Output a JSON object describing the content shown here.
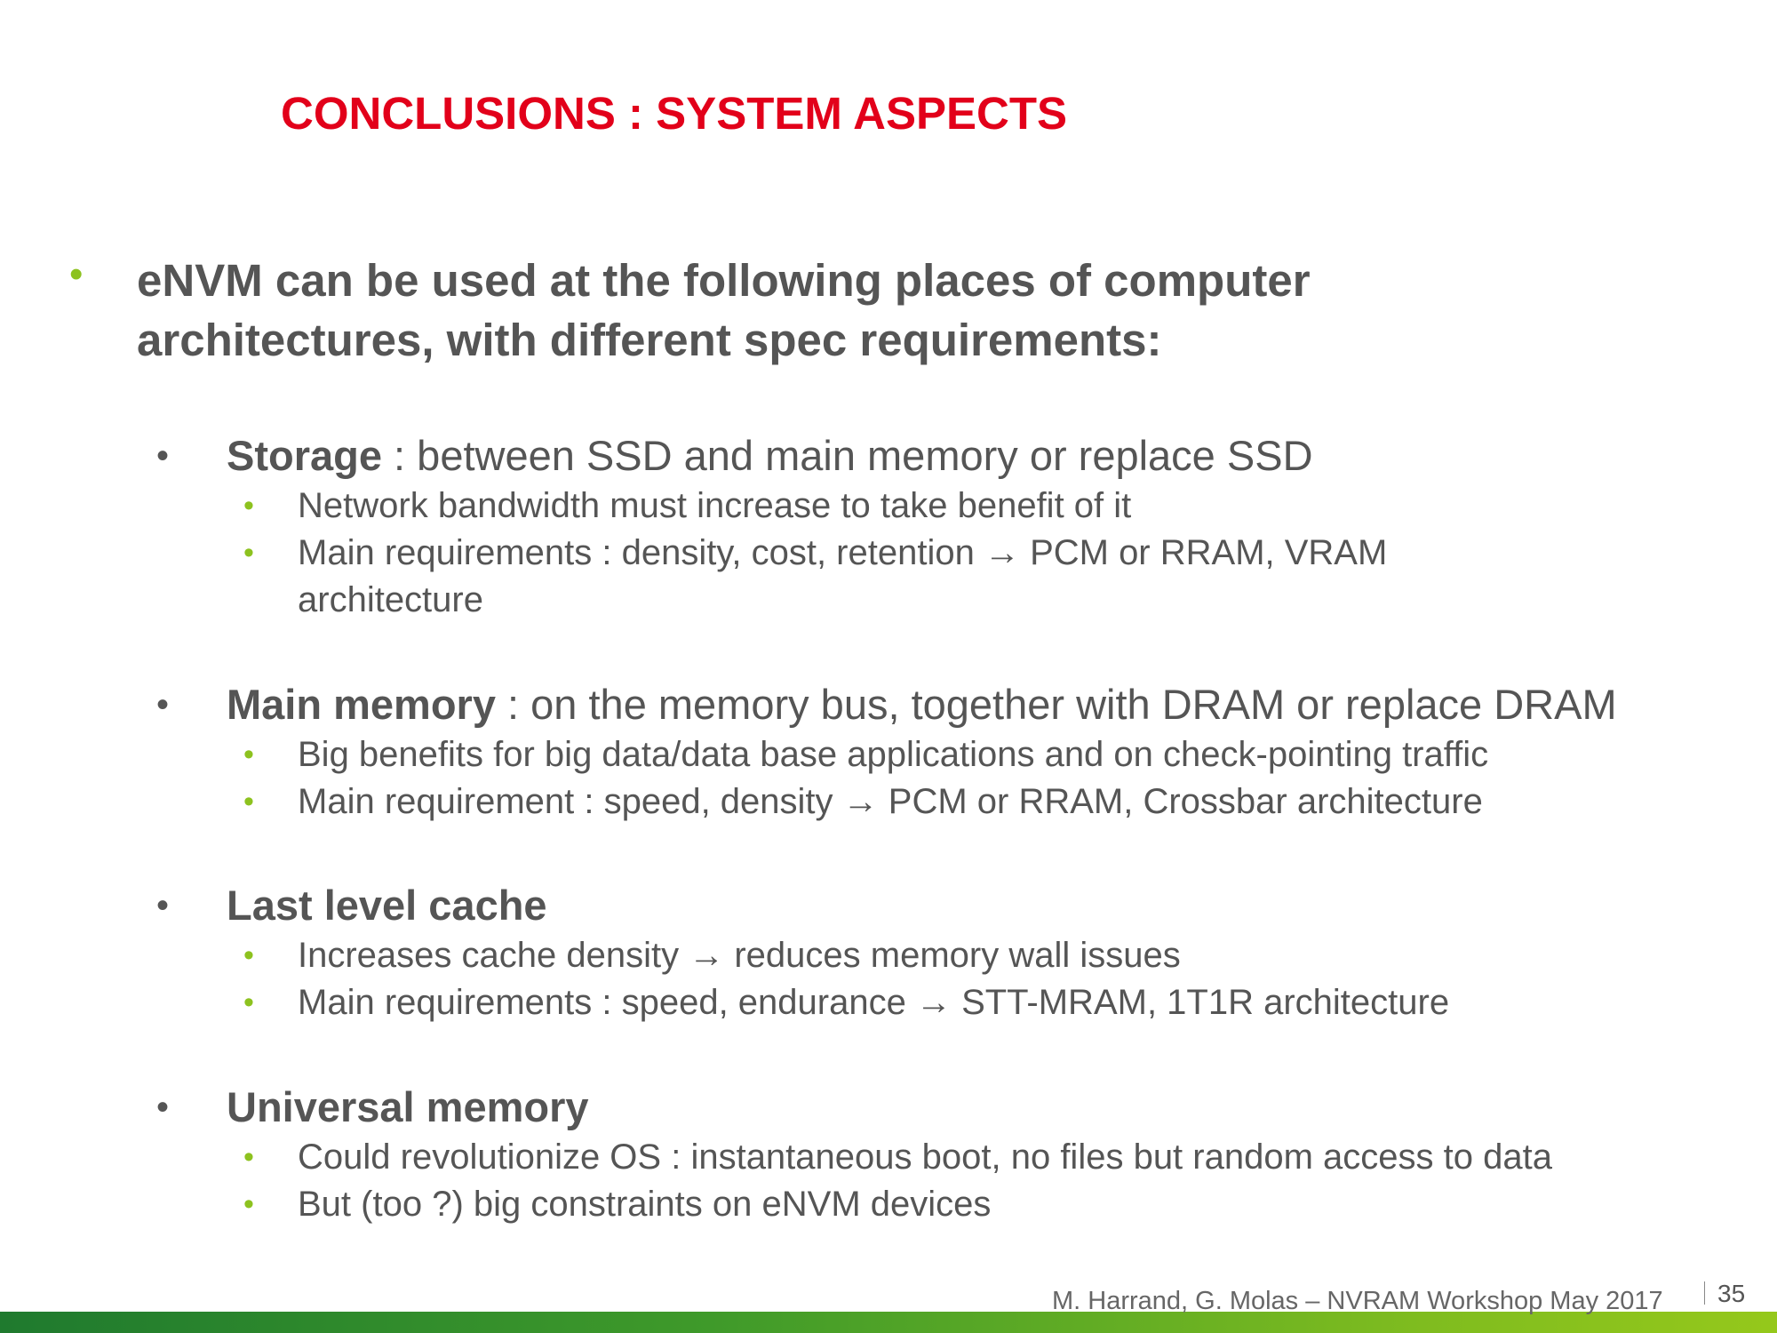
{
  "slide": {
    "title": "CONCLUSIONS : SYSTEM ASPECTS",
    "intro": {
      "bullet": "•",
      "text": "eNVM can be used at the following places of computer architectures, with different spec requirements:"
    },
    "sections": [
      {
        "bullet": "•",
        "heading": "Storage",
        "rest": " : between SSD and main memory or replace SSD",
        "subs": [
          "Network bandwidth must increase to take benefit of it",
          "Main requirements : density, cost, retention → PCM or RRAM, VRAM architecture"
        ]
      },
      {
        "bullet": "•",
        "heading": "Main memory",
        "rest": " : on the memory bus, together with DRAM or replace DRAM",
        "subs": [
          "Big benefits for big data/data base applications and on check-pointing traffic",
          "Main requirement : speed, density → PCM or RRAM, Crossbar architecture"
        ]
      },
      {
        "bullet": "•",
        "heading": "Last level cache",
        "rest": "",
        "subs": [
          "Increases cache density → reduces memory wall issues",
          "Main requirements : speed, endurance → STT-MRAM, 1T1R architecture"
        ]
      },
      {
        "bullet": "•",
        "heading": "Universal memory",
        "rest": "",
        "subs": [
          "Could revolutionize OS : instantaneous boot, no files but random access to data",
          "But (too ?) big constraints on eNVM devices"
        ]
      }
    ],
    "sub_bullet": "•",
    "footer": "M. Harrand, G. Molas – NVRAM Workshop May 2017",
    "page_number": "35",
    "colors": {
      "title": "#e2001a",
      "bullet_green": "#8dc21f",
      "text": "#555555",
      "bar_start": "#1f7a2e",
      "bar_end": "#95c81b"
    }
  }
}
